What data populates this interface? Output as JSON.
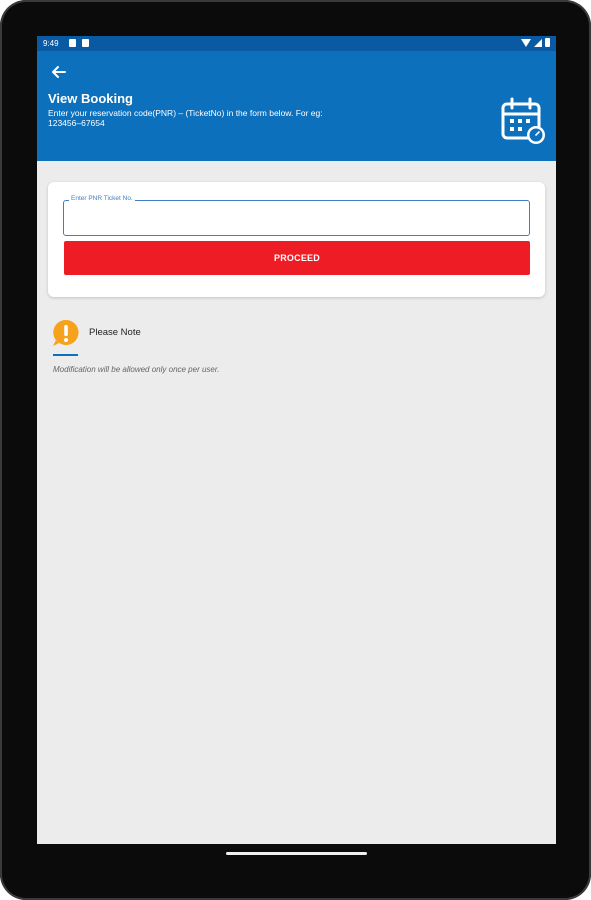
{
  "status_bar": {
    "time": "9:49"
  },
  "header": {
    "title": "View Booking",
    "subtitle": "Enter your reservation code(PNR) – (TicketNo) in the form below. For eg: 123456–67654",
    "icon": "calendar-clock-icon"
  },
  "form": {
    "field_label": "Enter PNR Ticket No.",
    "field_value": "",
    "proceed_label": "PROCEED"
  },
  "note": {
    "icon": "warning-exclamation-icon",
    "title": "Please Note",
    "text": "Modification will be allowed only once per user."
  },
  "colors": {
    "appbar": "#0c70bd",
    "statusbar": "#0a5aa3",
    "button": "#ee1c24",
    "note_icon": "#f6a21c"
  }
}
